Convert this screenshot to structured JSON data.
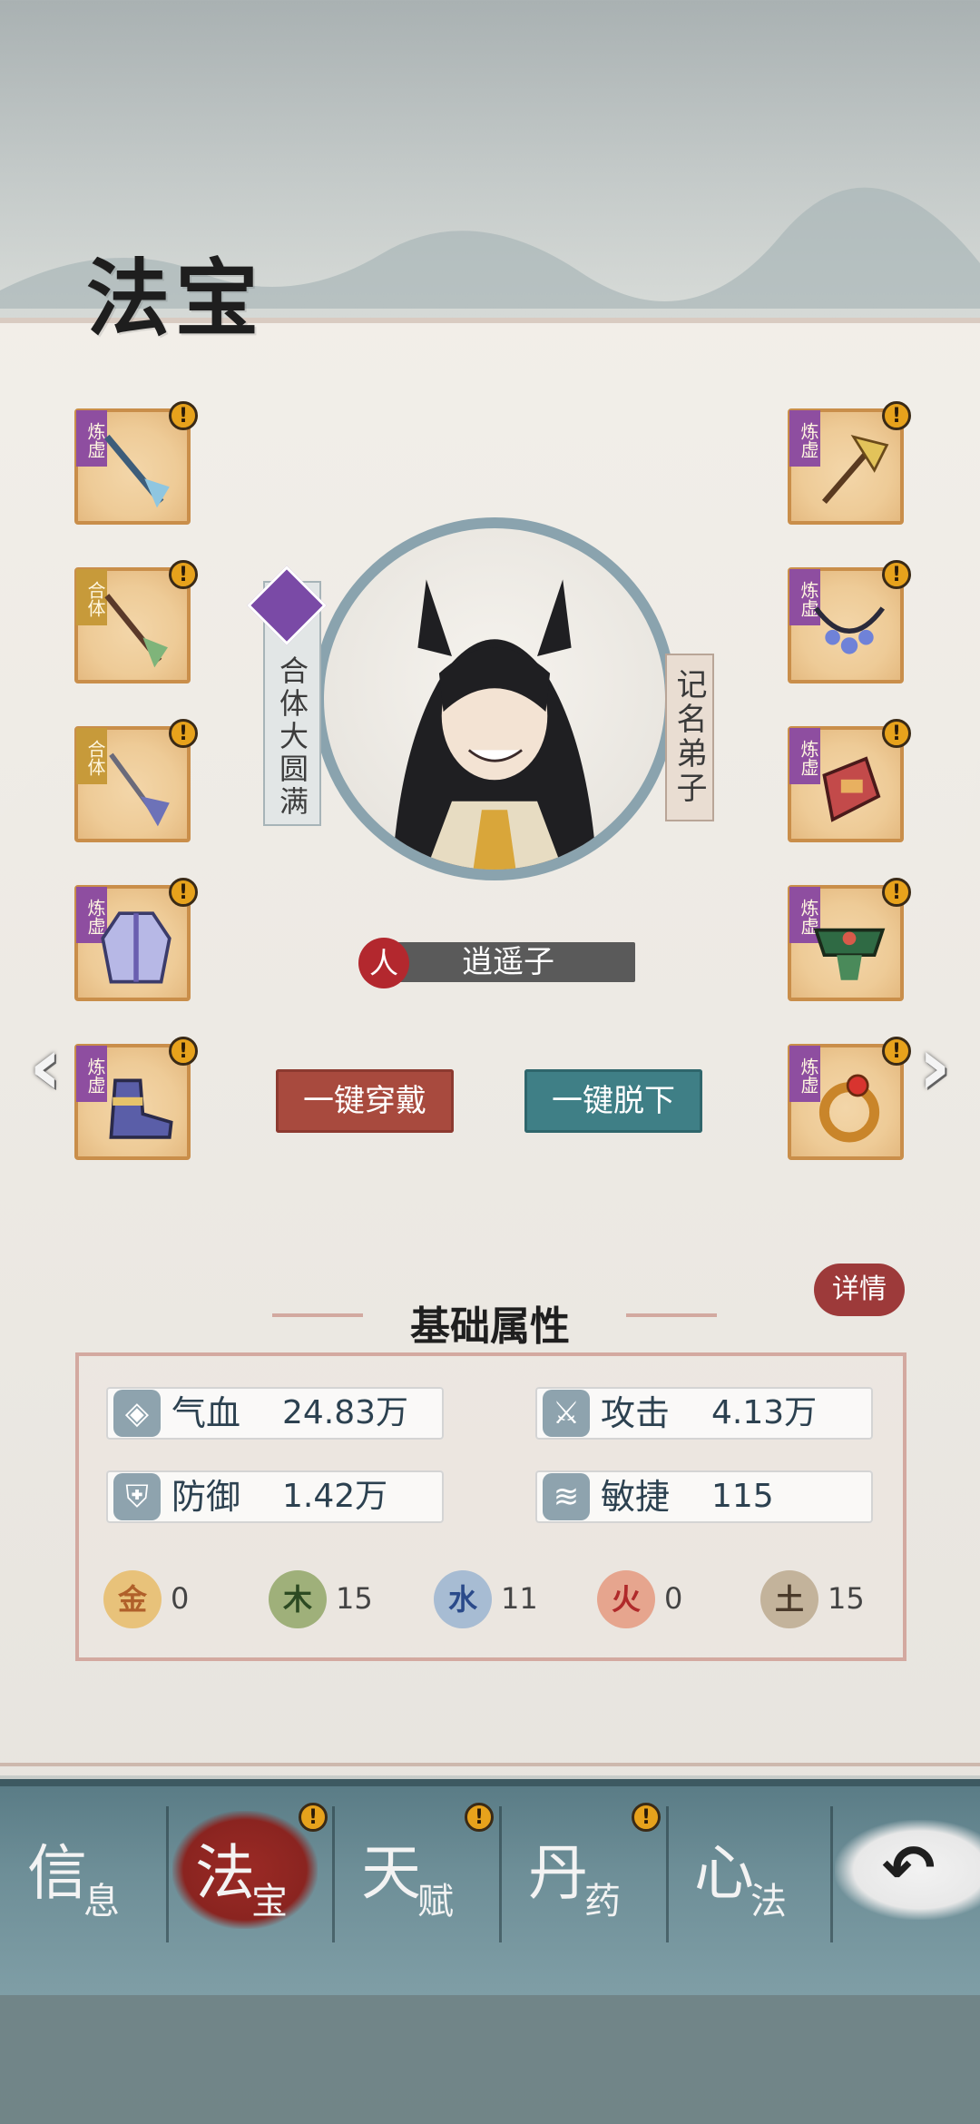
{
  "page": {
    "title": "法宝"
  },
  "left_slots": [
    {
      "tag": "炼虚",
      "tag_color": "#8e4ea0",
      "alert": "!",
      "icon": "spear-icon"
    },
    {
      "tag": "合体",
      "tag_color": "#c79a3a",
      "alert": "!",
      "icon": "jade-spear-icon"
    },
    {
      "tag": "合体",
      "tag_color": "#c79a3a",
      "alert": "!",
      "icon": "crystal-spear-icon"
    },
    {
      "tag": "炼虚",
      "tag_color": "#8e4ea0",
      "alert": "!",
      "icon": "robe-icon"
    },
    {
      "tag": "炼虚",
      "tag_color": "#8e4ea0",
      "alert": "!",
      "icon": "boots-icon"
    }
  ],
  "right_slots": [
    {
      "tag": "炼虚",
      "tag_color": "#8e4ea0",
      "alert": "!",
      "icon": "fan-scepter-icon"
    },
    {
      "tag": "炼虚",
      "tag_color": "#8e4ea0",
      "alert": "!",
      "icon": "necklace-icon"
    },
    {
      "tag": "炼虚",
      "tag_color": "#8e4ea0",
      "alert": "!",
      "icon": "bracer-icon"
    },
    {
      "tag": "炼虚",
      "tag_color": "#8e4ea0",
      "alert": "!",
      "icon": "belt-icon"
    },
    {
      "tag": "炼虚",
      "tag_color": "#8e4ea0",
      "alert": "!",
      "icon": "ring-icon"
    }
  ],
  "character": {
    "realm": "合体大圆满",
    "rank": "记名弟子",
    "race": "人",
    "name": "逍遥子"
  },
  "buttons": {
    "equip_all": "一键穿戴",
    "unequip_all": "一键脱下",
    "detail": "详情",
    "prev": "‹",
    "next": "›"
  },
  "attributes": {
    "title": "基础属性",
    "stats": [
      {
        "label": "气血",
        "value": "24.83万",
        "icon": "blood-drop-icon"
      },
      {
        "label": "攻击",
        "value": "4.13万",
        "icon": "sword-icon"
      },
      {
        "label": "防御",
        "value": "1.42万",
        "icon": "shield-icon"
      },
      {
        "label": "敏捷",
        "value": "115",
        "icon": "wing-icon"
      }
    ],
    "elements": [
      {
        "glyph": "金",
        "value": "0",
        "color": "#e8c27a"
      },
      {
        "glyph": "木",
        "value": "15",
        "color": "#9fb07a"
      },
      {
        "glyph": "水",
        "value": "11",
        "color": "#a7bcd3"
      },
      {
        "glyph": "火",
        "value": "0",
        "color": "#e6a58e"
      },
      {
        "glyph": "土",
        "value": "15",
        "color": "#c3b39b"
      }
    ]
  },
  "nav": {
    "tabs": [
      {
        "big": "信",
        "small": "息",
        "alert": ""
      },
      {
        "big": "法",
        "small": "宝",
        "alert": "!"
      },
      {
        "big": "天",
        "small": "赋",
        "alert": "!"
      },
      {
        "big": "丹",
        "small": "药",
        "alert": "!"
      },
      {
        "big": "心",
        "small": "法",
        "alert": ""
      }
    ],
    "back_icon": "back-arrow-icon",
    "back_glyph": "↶"
  },
  "colors": {
    "accent_red": "#a84a3e",
    "accent_teal": "#3f7f86",
    "alert": "#e7a21c",
    "nav_bg": "#6d8e97"
  }
}
